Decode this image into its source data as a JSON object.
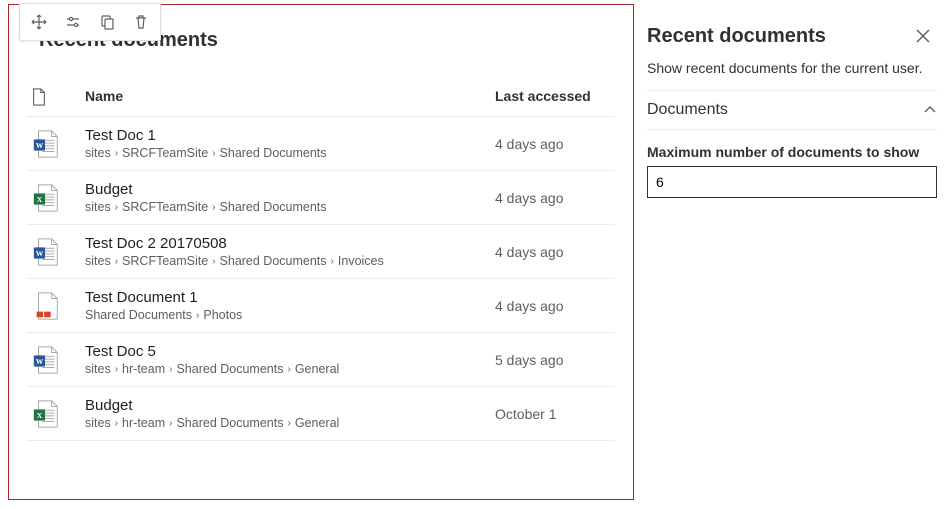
{
  "panel": {
    "title": "Recent documents",
    "columns": {
      "name": "Name",
      "last": "Last accessed"
    }
  },
  "documents": [
    {
      "icon": "word",
      "title": "Test Doc 1",
      "pathParts": [
        "sites",
        "SRCFTeamSite",
        "Shared Documents"
      ],
      "last": "4 days ago"
    },
    {
      "icon": "excel",
      "title": "Budget",
      "pathParts": [
        "sites",
        "SRCFTeamSite",
        "Shared Documents"
      ],
      "last": "4 days ago"
    },
    {
      "icon": "word",
      "title": "Test Doc 2 20170508",
      "pathParts": [
        "sites",
        "SRCFTeamSite",
        "Shared Documents",
        "Invoices"
      ],
      "last": "4 days ago"
    },
    {
      "icon": "ppt",
      "title": "Test Document 1",
      "pathParts": [
        "Shared Documents",
        "Photos"
      ],
      "last": "4 days ago"
    },
    {
      "icon": "word",
      "title": "Test Doc 5",
      "pathParts": [
        "sites",
        "hr-team",
        "Shared Documents",
        "General"
      ],
      "last": "5 days ago"
    },
    {
      "icon": "excel",
      "title": "Budget",
      "pathParts": [
        "sites",
        "hr-team",
        "Shared Documents",
        "General"
      ],
      "last": "October 1"
    }
  ],
  "propsPane": {
    "title": "Recent documents",
    "subtitle": "Show recent documents for the current user.",
    "section": "Documents",
    "maxLabel": "Maximum number of documents to show",
    "maxValue": "6"
  },
  "toolbarIcons": {
    "move": "move-icon",
    "settings": "sliders-icon",
    "copy": "copy-icon",
    "delete": "trash-icon"
  }
}
